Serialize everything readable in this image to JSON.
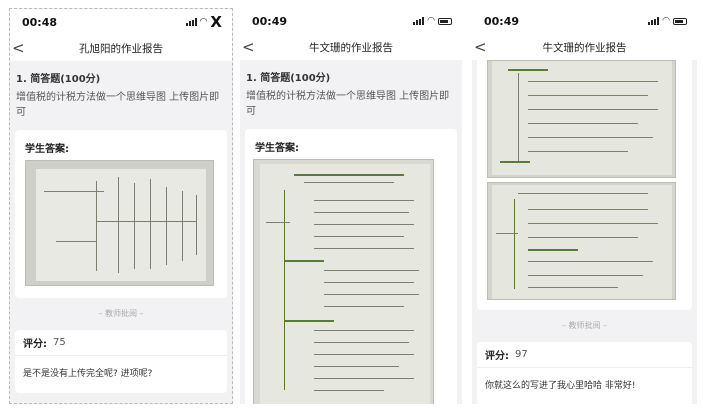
{
  "phones": [
    {
      "time": "00:48",
      "nav_back": "<",
      "title": "孔旭阳的作业报告",
      "close": "X",
      "question_heading": "1. 简答题(100分)",
      "question_text": "增值税的计税方法做一个思维导图 上传图片即可",
      "answer_label": "学生答案:",
      "divider": "– 教师批阅 –",
      "score_label": "评分:",
      "score": "75",
      "comment": "是不是没有上传完全呢? 进项呢?"
    },
    {
      "time": "00:49",
      "nav_back": "<",
      "title": "牛文珊的作业报告",
      "question_heading": "1. 简答题(100分)",
      "question_text": "增值税的计税方法做一个思维导图 上传图片即可",
      "answer_label": "学生答案:"
    },
    {
      "time": "00:49",
      "nav_back": "<",
      "title": "牛文珊的作业报告",
      "divider": "– 教师批阅 –",
      "score_label": "评分:",
      "score": "97",
      "comment": "你就这么的写进了我心里哈哈 非常好!"
    }
  ],
  "icons": {
    "signal": "signal-icon",
    "wifi": "wifi-icon",
    "battery": "battery-icon",
    "back": "chevron-left-icon",
    "close": "close-icon"
  }
}
